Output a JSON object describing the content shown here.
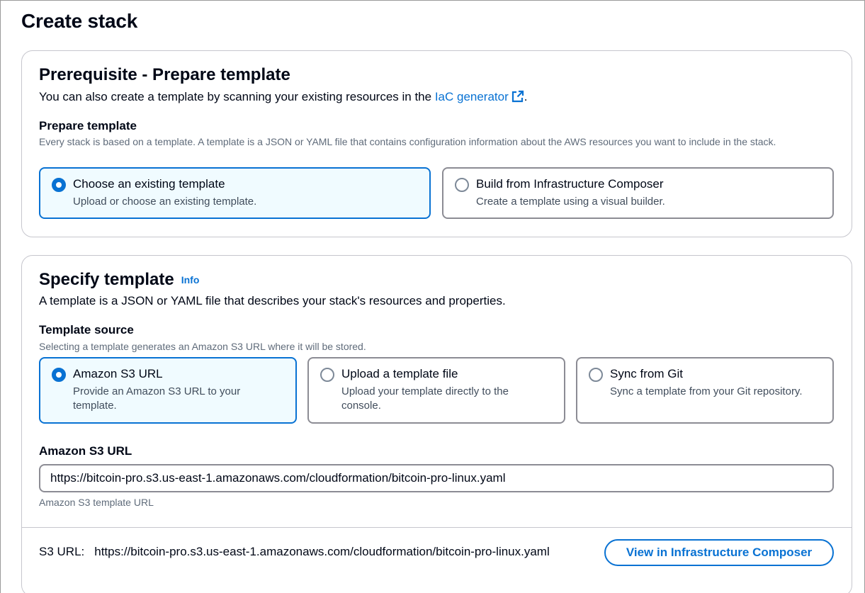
{
  "page": {
    "title": "Create stack"
  },
  "prerequisite": {
    "heading": "Prerequisite - Prepare template",
    "desc_prefix": "You can also create a template by scanning your existing resources in the ",
    "link_text": "IaC generator",
    "desc_suffix": ".",
    "field_label": "Prepare template",
    "field_desc": "Every stack is based on a template. A template is a JSON or YAML file that contains configuration information about the AWS resources you want to include in the stack.",
    "options": [
      {
        "title": "Choose an existing template",
        "desc": "Upload or choose an existing template.",
        "selected": true
      },
      {
        "title": "Build from Infrastructure Composer",
        "desc": "Create a template using a visual builder.",
        "selected": false
      }
    ]
  },
  "specify": {
    "heading": "Specify template",
    "info_link": "Info",
    "desc": "A template is a JSON or YAML file that describes your stack's resources and properties.",
    "field_label": "Template source",
    "field_desc": "Selecting a template generates an Amazon S3 URL where it will be stored.",
    "options": [
      {
        "title": "Amazon S3 URL",
        "desc": "Provide an Amazon S3 URL to your template.",
        "selected": true
      },
      {
        "title": "Upload a template file",
        "desc": "Upload your template directly to the console.",
        "selected": false
      },
      {
        "title": "Sync from Git",
        "desc": "Sync a template from your Git repository.",
        "selected": false
      }
    ],
    "url_label": "Amazon S3 URL",
    "url_value": "https://bitcoin-pro.s3.us-east-1.amazonaws.com/cloudformation/bitcoin-pro-linux.yaml",
    "url_constraint": "Amazon S3 template URL",
    "s3_url_label": "S3 URL:",
    "s3_url_value": "https://bitcoin-pro.s3.us-east-1.amazonaws.com/cloudformation/bitcoin-pro-linux.yaml",
    "composer_button": "View in Infrastructure Composer"
  },
  "colors": {
    "accent": "#0972d3",
    "selected_bg": "#f0fbff",
    "text": "#000716",
    "muted": "#5f6b7a"
  },
  "icons": {
    "external": "external-link-icon"
  }
}
